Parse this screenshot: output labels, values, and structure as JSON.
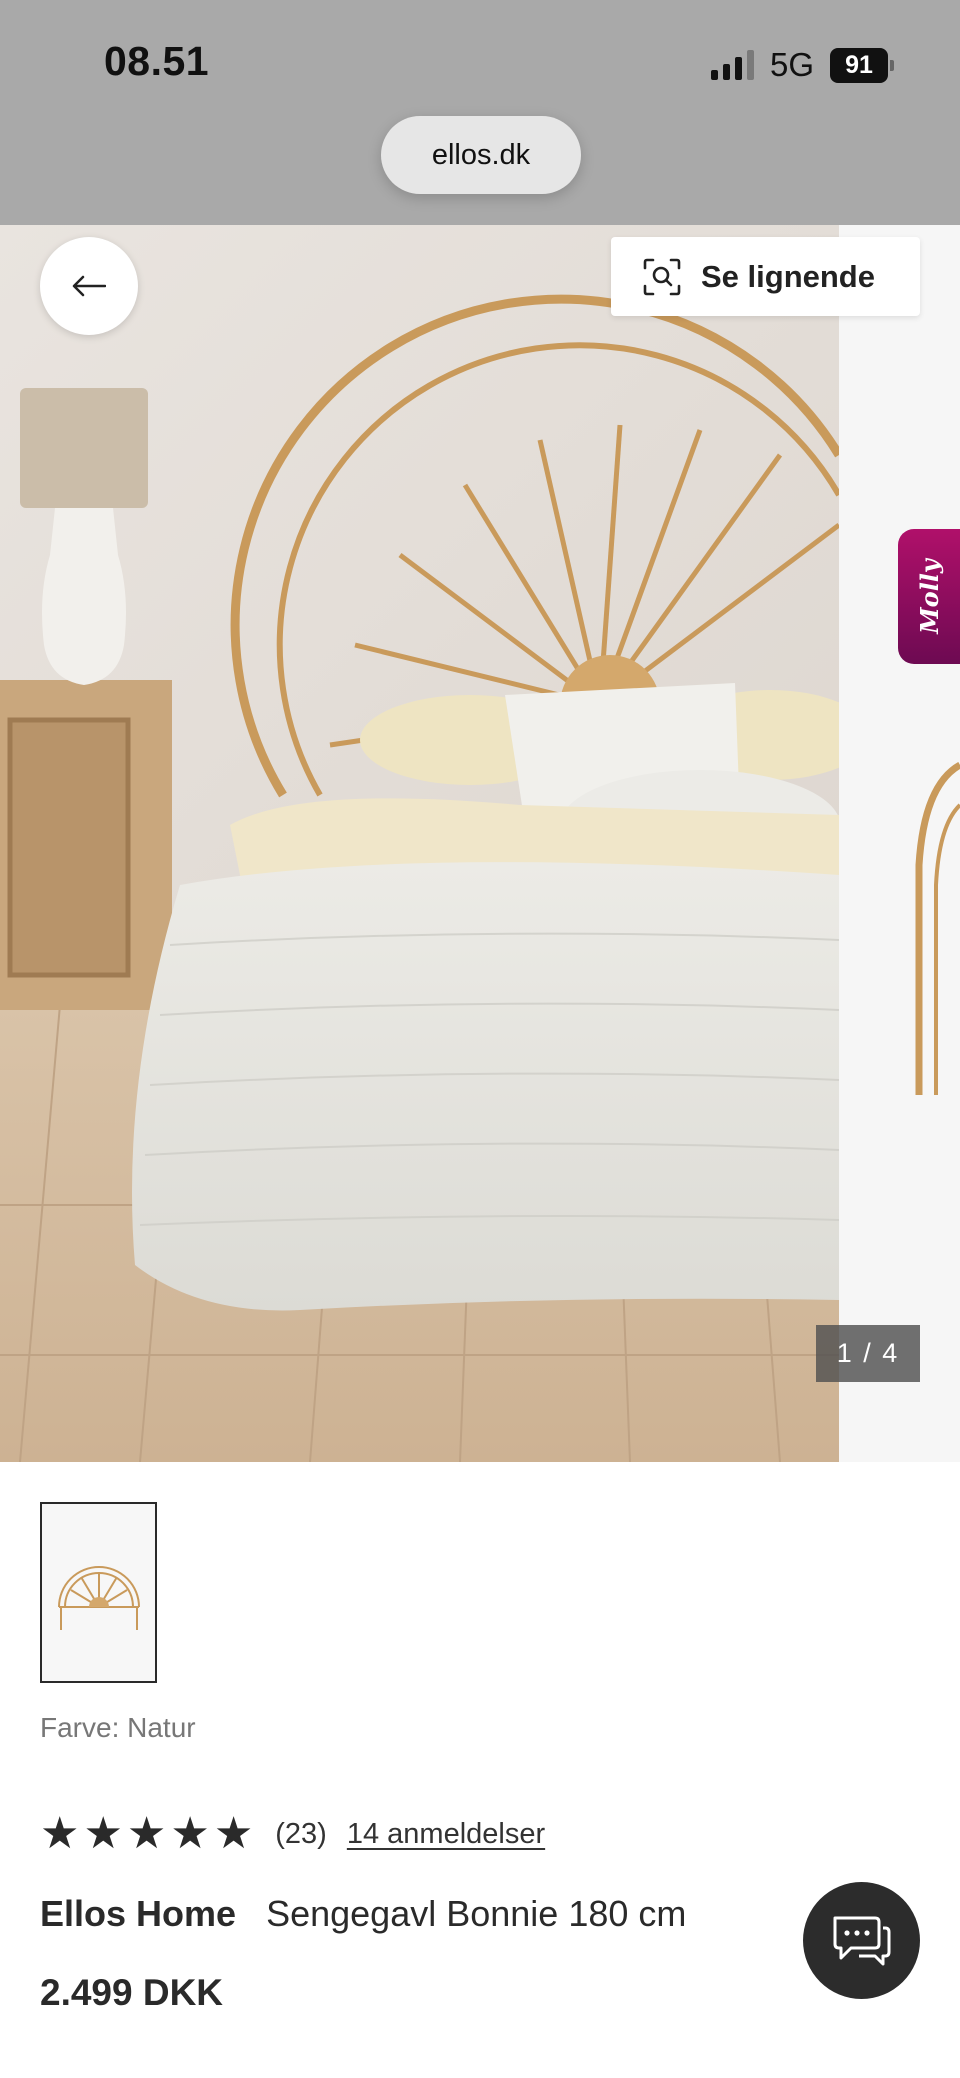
{
  "status_bar": {
    "time": "08.51",
    "network": "5G",
    "battery": "91"
  },
  "browser": {
    "url": "ellos.dk"
  },
  "gallery": {
    "back_icon": "arrow-left-icon",
    "similar_label": "Se lignende",
    "similar_icon": "visual-search-icon",
    "molly_label": "Molly",
    "counter": "1 / 4"
  },
  "product": {
    "color_label": "Farve: Natur",
    "rating": 5,
    "rating_count": "(23)",
    "reviews_link": "14 anmeldelser",
    "brand": "Ellos Home",
    "name": "Sengegavl Bonnie 180 cm",
    "price": "2.499 DKK"
  },
  "chat": {
    "icon": "chat-bubbles-icon"
  },
  "colors": {
    "chrome": "#a9a9a9",
    "text": "#2a2a2a",
    "molly_accent": "#9c0f62",
    "chat_button": "#2c2c2c"
  }
}
